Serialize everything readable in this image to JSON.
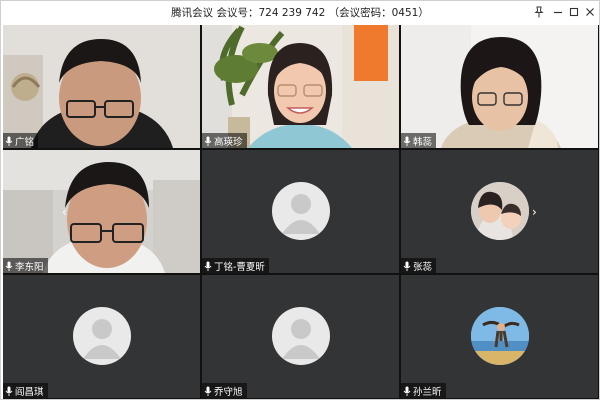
{
  "window": {
    "title": "腾讯会议 会议号：724 239 742 （会议密码：0451）",
    "controls": [
      "pin",
      "minimize",
      "maximize",
      "close"
    ]
  },
  "participants": [
    {
      "name": "广铭",
      "video": "on"
    },
    {
      "name": "高瑛珍",
      "video": "on"
    },
    {
      "name": "韩蕊",
      "video": "on"
    },
    {
      "name": "李东阳",
      "video": "on"
    },
    {
      "name": "丁铭-曹夏昕",
      "video": "off"
    },
    {
      "name": "张蕊",
      "video": "off"
    },
    {
      "name": "阎昌琪",
      "video": "off"
    },
    {
      "name": "乔守旭",
      "video": "off"
    },
    {
      "name": "孙兰昕",
      "video": "off"
    }
  ],
  "icons": {
    "name_tag": "microphone-icon",
    "pager_prev": "chevron-left-icon",
    "pager_next": "chevron-right-icon"
  },
  "colors": {
    "grid_bg": "#111111",
    "empty_tile": "#333435",
    "name_tag_bg": "rgba(0,0,0,0.55)"
  }
}
